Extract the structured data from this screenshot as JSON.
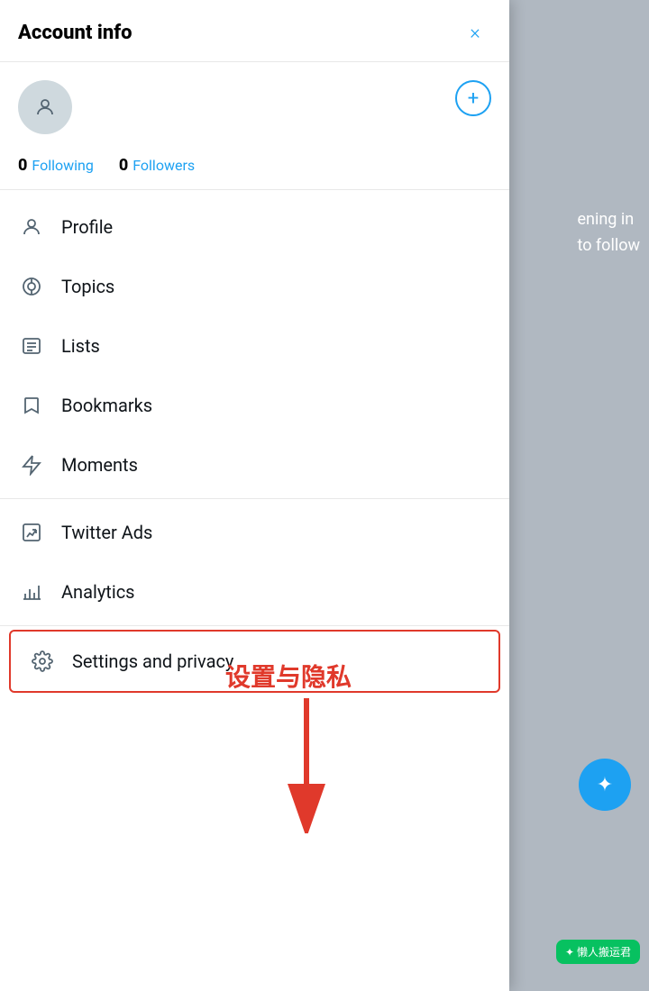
{
  "header": {
    "title": "Account info",
    "close_label": "×"
  },
  "stats": {
    "following_count": "0",
    "following_label": "Following",
    "followers_count": "0",
    "followers_label": "Followers"
  },
  "menu_items": [
    {
      "id": "profile",
      "label": "Profile",
      "icon": "person"
    },
    {
      "id": "topics",
      "label": "Topics",
      "icon": "topics"
    },
    {
      "id": "lists",
      "label": "Lists",
      "icon": "lists"
    },
    {
      "id": "bookmarks",
      "label": "Bookmarks",
      "icon": "bookmark"
    },
    {
      "id": "moments",
      "label": "Moments",
      "icon": "bolt"
    },
    {
      "id": "twitter-ads",
      "label": "Twitter Ads",
      "icon": "ads"
    },
    {
      "id": "analytics",
      "label": "Analytics",
      "icon": "analytics"
    },
    {
      "id": "settings",
      "label": "Settings and privacy",
      "icon": "gear",
      "highlighted": true
    }
  ],
  "annotation": {
    "text": "设置与隐私"
  },
  "fab": {
    "icon": "✦"
  },
  "wechat": {
    "label": "✦ 懒人搬运君"
  },
  "background": {
    "lines": [
      "ening in",
      "to follow"
    ]
  }
}
